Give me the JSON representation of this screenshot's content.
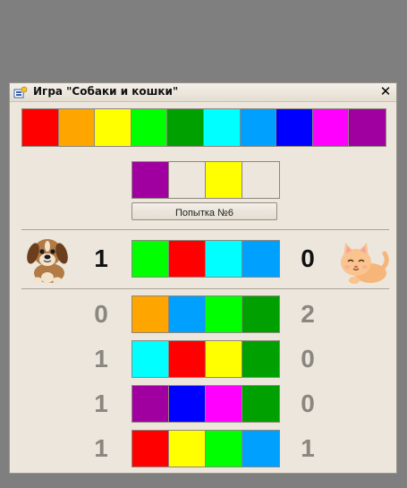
{
  "window": {
    "title": "Игра \"Собаки и кошки\"",
    "close_symbol": "✕"
  },
  "colors": {
    "red": "#ff0000",
    "orange": "#ffa500",
    "yellow": "#ffff00",
    "lime": "#00ff00",
    "green": "#00a000",
    "cyan": "#00ffff",
    "azure": "#00a0ff",
    "blue": "#0000ff",
    "magenta": "#ff00ff",
    "purple": "#a000a0",
    "empty": "#ece6dc"
  },
  "palette": [
    "red",
    "orange",
    "yellow",
    "lime",
    "green",
    "cyan",
    "azure",
    "blue",
    "magenta",
    "purple"
  ],
  "current_guess": [
    "purple",
    "empty",
    "yellow",
    "empty"
  ],
  "attempt_button": {
    "label": "Попытка №6"
  },
  "last_result": {
    "dogs": "1",
    "cats": "0",
    "colors": [
      "lime",
      "red",
      "cyan",
      "azure"
    ]
  },
  "history": [
    {
      "dogs": "0",
      "cats": "2",
      "colors": [
        "orange",
        "azure",
        "lime",
        "green"
      ]
    },
    {
      "dogs": "1",
      "cats": "0",
      "colors": [
        "cyan",
        "red",
        "yellow",
        "green"
      ]
    },
    {
      "dogs": "1",
      "cats": "0",
      "colors": [
        "purple",
        "blue",
        "magenta",
        "green"
      ]
    },
    {
      "dogs": "1",
      "cats": "1",
      "colors": [
        "red",
        "yellow",
        "lime",
        "azure"
      ]
    }
  ]
}
